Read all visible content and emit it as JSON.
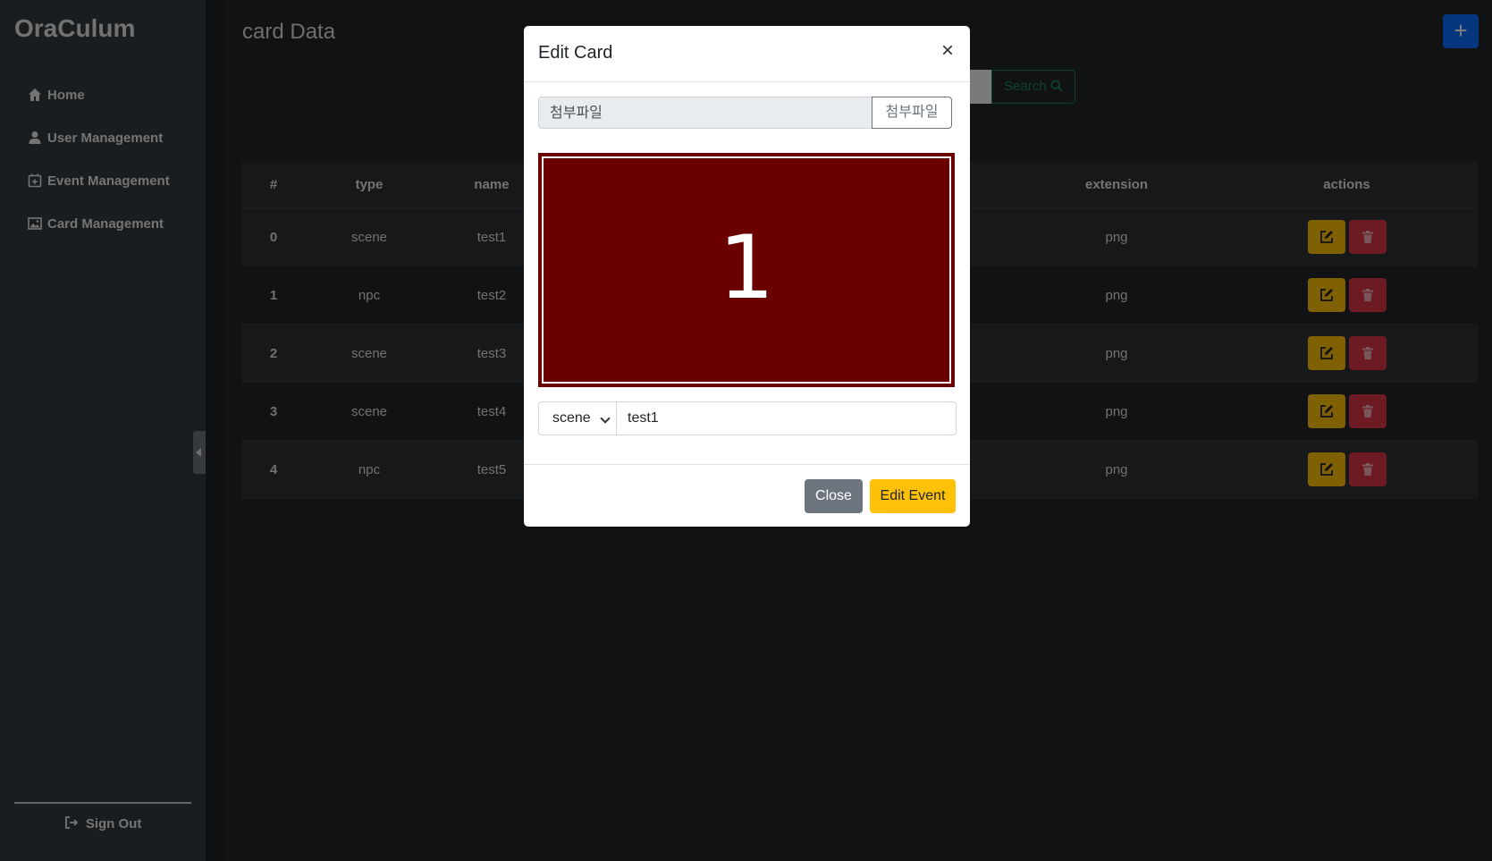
{
  "brand": "OraCulum",
  "sidebar": {
    "items": [
      {
        "label": "Home",
        "icon": "house-icon"
      },
      {
        "label": "User Management",
        "icon": "user-icon"
      },
      {
        "label": "Event Management",
        "icon": "calendar-plus-icon"
      },
      {
        "label": "Card Management",
        "icon": "image-icon"
      }
    ],
    "signout": "Sign Out"
  },
  "page": {
    "title": "card Data",
    "add_label": "+",
    "search_label": "Search"
  },
  "table": {
    "columns": [
      "#",
      "type",
      "name",
      "extension",
      "actions"
    ],
    "rows": [
      {
        "idx": "0",
        "type": "scene",
        "name": "test1",
        "ext": "png"
      },
      {
        "idx": "1",
        "type": "npc",
        "name": "test2",
        "ext": "png"
      },
      {
        "idx": "2",
        "type": "scene",
        "name": "test3",
        "ext": "png"
      },
      {
        "idx": "3",
        "type": "scene",
        "name": "test4",
        "ext": "png"
      },
      {
        "idx": "4",
        "type": "npc",
        "name": "test5",
        "ext": "png"
      }
    ]
  },
  "modal": {
    "title": "Edit Card",
    "close_x": "×",
    "file_placeholder": "첨부파일",
    "file_button": "첨부파일",
    "preview_text": "1",
    "type_value": "scene",
    "name_value": "test1",
    "close_button": "Close",
    "submit_button": "Edit Event"
  },
  "colors": {
    "sidebar": "#343a40",
    "primary": "#0d6efd",
    "warning": "#ffc107",
    "danger": "#dc3545",
    "success": "#198754",
    "preview": "#6a0000"
  }
}
